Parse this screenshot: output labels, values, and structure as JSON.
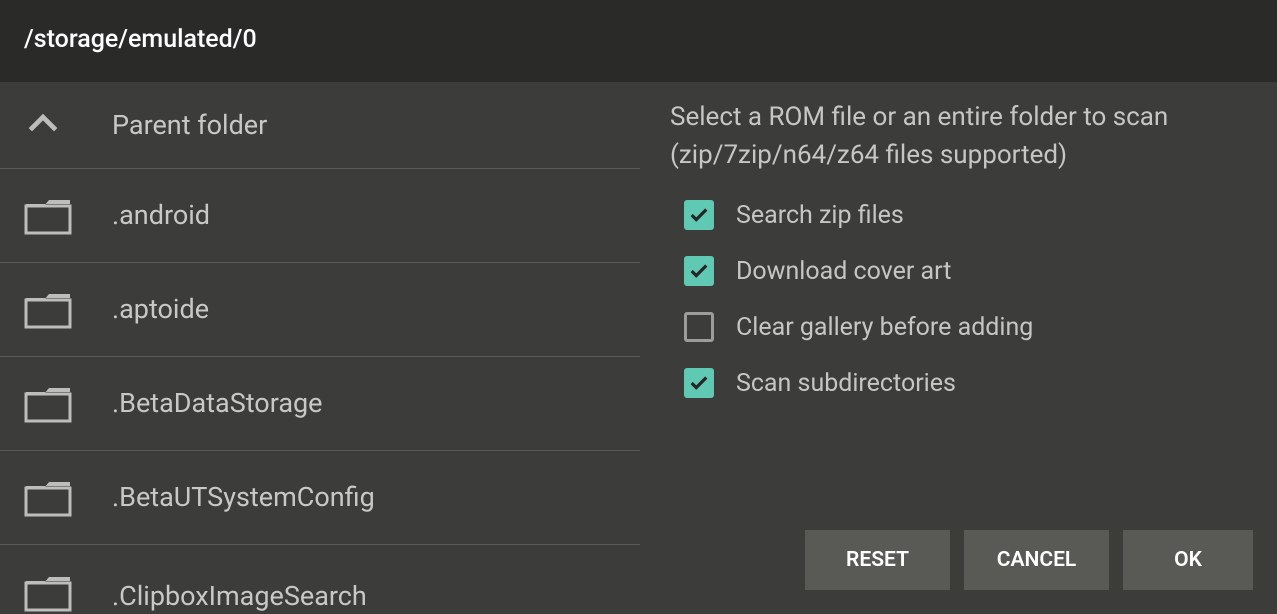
{
  "header": {
    "path": "/storage/emulated/0"
  },
  "filelist": {
    "parent_label": "Parent folder",
    "items": [
      {
        "label": ".android"
      },
      {
        "label": ".aptoide"
      },
      {
        "label": ".BetaDataStorage"
      },
      {
        "label": ".BetaUTSystemConfig"
      },
      {
        "label": ".ClipboxImageSearch"
      }
    ]
  },
  "right": {
    "instruction": "Select a ROM file or an entire folder to scan (zip/7zip/n64/z64 files supported)",
    "options": [
      {
        "label": "Search zip files",
        "checked": true
      },
      {
        "label": "Download cover art",
        "checked": true
      },
      {
        "label": "Clear gallery before adding",
        "checked": false
      },
      {
        "label": "Scan subdirectories",
        "checked": true
      }
    ],
    "buttons": {
      "reset": "RESET",
      "cancel": "CANCEL",
      "ok": "OK"
    }
  }
}
